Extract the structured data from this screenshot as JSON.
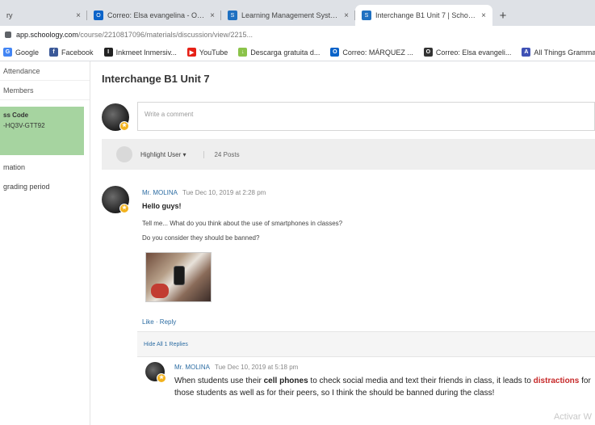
{
  "browser": {
    "tabs": [
      {
        "label": "ry",
        "icon": "",
        "color": "#dee1e6"
      },
      {
        "label": "Correo: Elsa evangelina - Outlo",
        "icon": "outlook-icon",
        "color": "#0a63c9"
      },
      {
        "label": "Learning Management System",
        "icon": "schoology-icon",
        "color": "#1f70c1"
      },
      {
        "label": "Interchange B1 Unit 7 | Schoolo",
        "icon": "schoology-icon",
        "color": "#1f70c1"
      }
    ],
    "new_tab": "+",
    "url_host": "app.schoology.com",
    "url_path": "/course/2210817096/materials/discussion/view/2215...",
    "bookmarks": [
      {
        "label": "Google",
        "icon": "google-icon",
        "color": "#4285f4",
        "glyph": "G"
      },
      {
        "label": "Facebook",
        "icon": "facebook-icon",
        "color": "#3b5998",
        "glyph": "f"
      },
      {
        "label": "Inkmeet Inmersiv...",
        "icon": "inkmeet-icon",
        "color": "#222222",
        "glyph": "I"
      },
      {
        "label": "YouTube",
        "icon": "youtube-icon",
        "color": "#e62117",
        "glyph": "▶"
      },
      {
        "label": "Descarga gratuita d...",
        "icon": "download-icon",
        "color": "#8bc34a",
        "glyph": "↓"
      },
      {
        "label": "Correo: MÁRQUEZ ...",
        "icon": "outlook-icon",
        "color": "#0a63c9",
        "glyph": "O"
      },
      {
        "label": "Correo: Elsa evangeli...",
        "icon": "outlook-icon",
        "color": "#333333",
        "glyph": "O"
      },
      {
        "label": "All Things Grammar",
        "icon": "grammar-icon",
        "color": "#3f51b5",
        "glyph": "A"
      }
    ]
  },
  "sidebar": {
    "items": [
      "Attendance",
      "Members"
    ],
    "code_label": "ss Code",
    "code_value": "-HQ3V-GTT92",
    "section_title": "mation",
    "section_sub": "grading period"
  },
  "main": {
    "title": "Interchange B1 Unit 7",
    "comment_placeholder": "Write a comment",
    "filter": "Highlight User ▾",
    "posts_count": "24 Posts"
  },
  "post": {
    "author": "Mr. MOLINA",
    "date": "Tue Dec 10, 2019 at 2:28 pm",
    "greeting": "Hello guys!",
    "line1": "Tell me... What do you think about the use of smartphones in classes?",
    "line2": "Do you consider they should be banned?",
    "actions": "Like · Reply"
  },
  "reply": {
    "hide_label": "Hide All 1 Replies",
    "author": "Mr. MOLINA",
    "date": "Tue Dec 10, 2019 at 5:18 pm",
    "part1": "When students use their ",
    "kw1": "cell phones",
    "part2": " to check social media and text their friends in class, it leads to ",
    "kw2": "distractions",
    "part3": " for those students as well as for their peers, so I think the should be banned during the class!"
  },
  "watermark": "Activar W"
}
